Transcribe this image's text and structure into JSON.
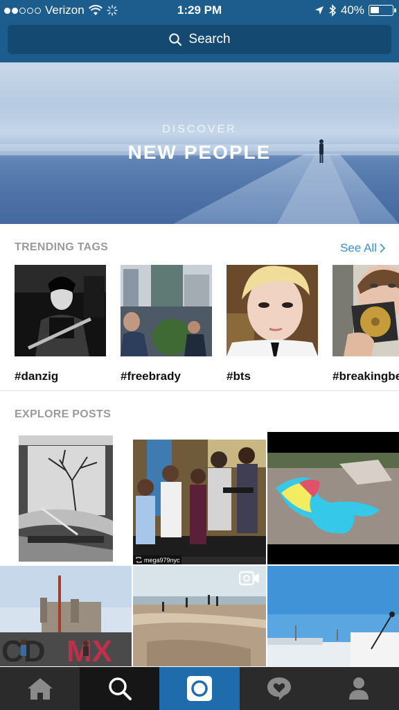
{
  "status_bar": {
    "carrier": "Verizon",
    "time": "1:29 PM",
    "battery": "40%",
    "battery_level": 0.4,
    "signal_bars_filled": 2,
    "signal_bars_total": 5
  },
  "search": {
    "label": "Search",
    "icon": "search-icon"
  },
  "banner": {
    "kicker": "DISCOVER",
    "title": "NEW PEOPLE"
  },
  "trending": {
    "heading": "TRENDING TAGS",
    "see_all": "See All",
    "tags": [
      {
        "label": "#danzig"
      },
      {
        "label": "#freebrady"
      },
      {
        "label": "#bts"
      },
      {
        "label": "#breakingbe"
      }
    ]
  },
  "explore": {
    "heading": "EXPLORE POSTS",
    "repost_user": "mega979nyc"
  },
  "tab_bar": {
    "items": [
      "home-icon",
      "search-icon",
      "camera-icon",
      "activity-heart-icon",
      "profile-icon"
    ],
    "active": "search"
  },
  "colors": {
    "header": "#1c5d8e",
    "search_field": "#144a72",
    "link": "#3b8fd6",
    "section_label": "#9a9a9a",
    "tabbar": "#2b2b2b",
    "camera_tab": "#1f6cad"
  }
}
